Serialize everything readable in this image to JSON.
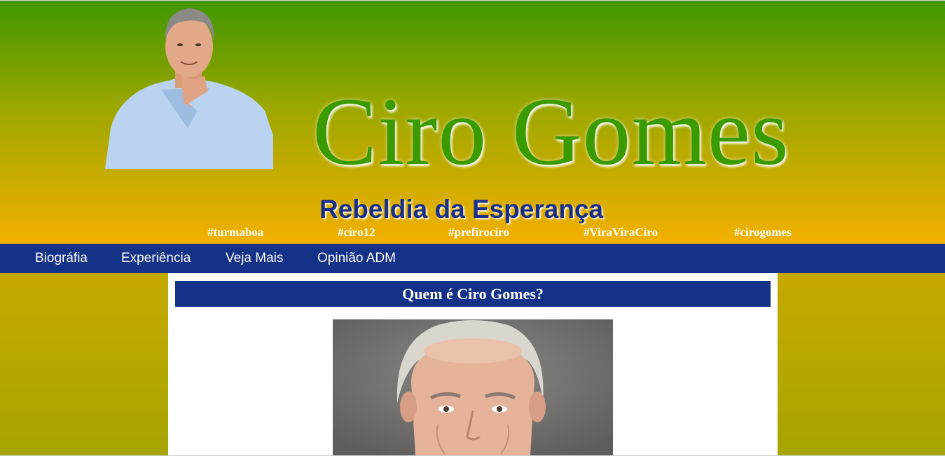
{
  "header": {
    "title": "Ciro Gomes",
    "subtitle": "Rebeldia da Esperança",
    "hashtags": [
      "#turmaboa",
      "#ciro12",
      "#prefirociro",
      "#ViraViraCiro",
      "#cirogomes"
    ]
  },
  "nav": {
    "items": [
      "Biográfia",
      "Experiência",
      "Veja Mais",
      "Opinião ADM"
    ]
  },
  "main": {
    "heading": "Quem é Ciro Gomes?"
  },
  "colors": {
    "nav_bg": "#143287",
    "title_green": "#3a9b00",
    "subtitle_blue": "#1a2f88",
    "gradient_top": "#3f9600",
    "gradient_mid": "#f2b000",
    "content_bg": "#ffffff"
  }
}
